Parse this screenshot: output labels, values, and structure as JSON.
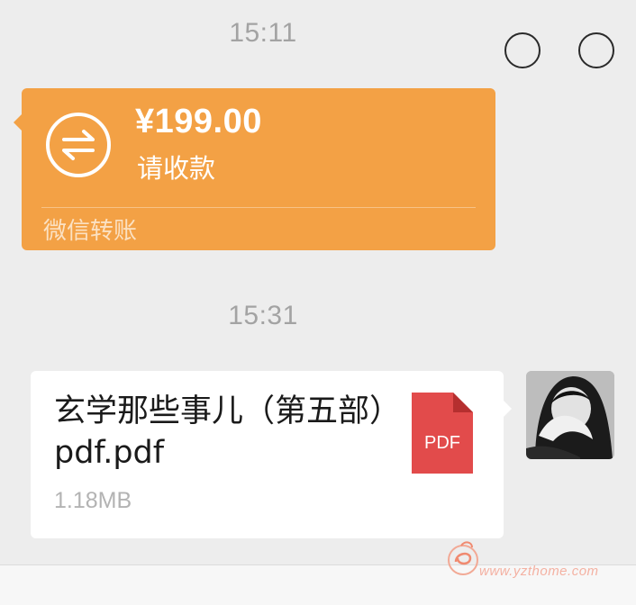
{
  "messages": {
    "timestamp_1": "15:11",
    "transfer": {
      "amount": "¥199.00",
      "status": "请收款",
      "footer": "微信转账",
      "icon": "transfer-arrows-icon",
      "color": "#f3a145"
    },
    "timestamp_2": "15:31",
    "file": {
      "name": "玄学那些事儿（第五部）pdf.pdf",
      "size": "1.18MB",
      "icon_label": "PDF",
      "icon_color": "#e24b4b"
    }
  },
  "watermark": {
    "text": "www.yzthome.com"
  }
}
